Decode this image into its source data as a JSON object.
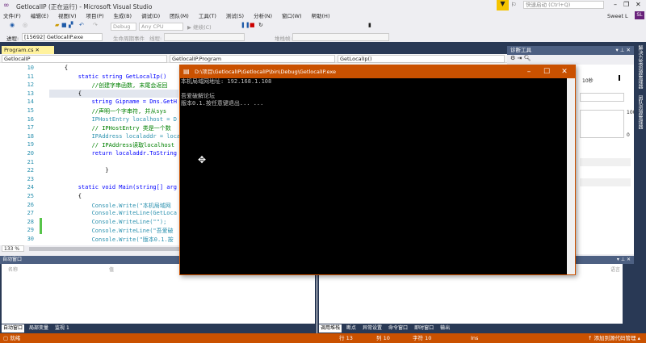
{
  "window": {
    "title": "GetlocalIP (正在运行) - Microsoft Visual Studio",
    "quick_launch": "快速启动 (Ctrl+Q)",
    "user": "Sweet L",
    "avatar": "SL"
  },
  "menu": [
    "文件(F)",
    "编辑(E)",
    "视图(V)",
    "项目(P)",
    "生成(B)",
    "调试(D)",
    "团队(M)",
    "工具(T)",
    "测试(S)",
    "分析(N)",
    "窗口(W)",
    "帮助(H)"
  ],
  "toolbar": {
    "config": "Debug",
    "platform": "Any CPU",
    "continue": "继续(C)"
  },
  "procbar": {
    "process_label": "进程:",
    "process": "[15692] GetlocalIP.exe",
    "lifecycle": "生命周期事件",
    "thread": "线程:",
    "stack": "堆栈帧:"
  },
  "editor": {
    "tab": "Program.cs",
    "nav_project": "GetlocalIP",
    "nav_class": "GetlocalIP.Program",
    "nav_member": "GetLocalIp()",
    "zoom": "133 %",
    "lines": [
      {
        "n": "10",
        "code": "    {"
      },
      {
        "n": "11",
        "code": "        static string GetLocalIp()"
      },
      {
        "n": "12",
        "code": "            //创建字串函数, 末尾会返回"
      },
      {
        "n": "13",
        "code": "        {"
      },
      {
        "n": "14",
        "code": "            string Gipname = Dns.GetH"
      },
      {
        "n": "15",
        "code": "            //声明一个字串符, 并从sys"
      },
      {
        "n": "16",
        "code": "            IPHostEntry localhost = D"
      },
      {
        "n": "17",
        "code": "            // IPHostEntry 类是一个数"
      },
      {
        "n": "18",
        "code": "            IPAddress localaddr = loca"
      },
      {
        "n": "19",
        "code": "            // IPAddress读取localhost"
      },
      {
        "n": "20",
        "code": "            return localaddr.ToString"
      },
      {
        "n": "21",
        "code": ""
      },
      {
        "n": "22",
        "code": "                }"
      },
      {
        "n": "23",
        "code": ""
      },
      {
        "n": "24",
        "code": "        static void Main(string[] arg"
      },
      {
        "n": "25",
        "code": "        {"
      },
      {
        "n": "26",
        "code": "            Console.Write(\"本机局域网"
      },
      {
        "n": "27",
        "code": "            Console.WriteLine(GetLoca"
      },
      {
        "n": "28",
        "code": "            Console.WriteLine(\"\");"
      },
      {
        "n": "29",
        "code": "            Console.WriteLine(\"吾爱破"
      },
      {
        "n": "30",
        "code": "            Console.Write(\"版本0.1.按"
      }
    ]
  },
  "diag": {
    "title": "诊断工具",
    "time": "10秒",
    "max": "100",
    "min": "0"
  },
  "side_tabs": [
    "解决方案资源管理器",
    "团队资源管理器"
  ],
  "autos": {
    "title": "自动窗口",
    "col_name": "名称",
    "col_value": "值",
    "tabs": [
      "自动窗口",
      "局部变量",
      "监视 1"
    ]
  },
  "callstack": {
    "col_lang": "语言",
    "tabs": [
      "调用堆栈",
      "断点",
      "异常设置",
      "命令窗口",
      "即时窗口",
      "输出"
    ]
  },
  "console": {
    "title": "D:\\项目\\GetlocalIP\\GetlocalIP\\bin\\Debug\\GetlocalIP.exe",
    "output": "本机局域网地址: 192.168.1.108\n\n吾爱破解论坛\n版本0.1.按任意键退出... ..."
  },
  "status": {
    "ready": "就绪",
    "line": "行 13",
    "col": "列 10",
    "char": "字符 10",
    "ins": "Ins",
    "source_control": "添加到源代码管理"
  },
  "colors": {
    "accent": "#ca5100",
    "frame": "#293955"
  }
}
